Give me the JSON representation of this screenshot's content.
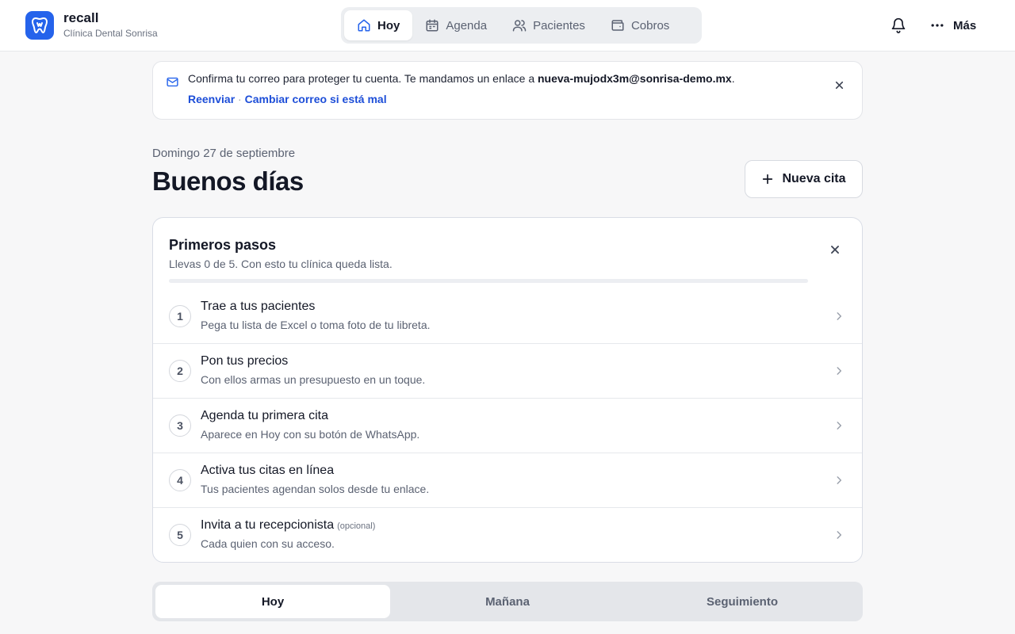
{
  "brand": {
    "name": "recall",
    "clinic": "Clínica Dental Sonrisa",
    "logo_icon": "tooth-icon",
    "accent": "#2563eb"
  },
  "nav": {
    "items": [
      {
        "label": "Hoy",
        "icon": "home-icon",
        "active": true
      },
      {
        "label": "Agenda",
        "icon": "calendar-icon",
        "active": false
      },
      {
        "label": "Pacientes",
        "icon": "users-icon",
        "active": false
      },
      {
        "label": "Cobros",
        "icon": "wallet-icon",
        "active": false
      }
    ],
    "more_label": "Más",
    "notifications_icon": "bell-icon"
  },
  "banner": {
    "icon": "mail-icon",
    "message": "Confirma tu correo para proteger tu cuenta. Te mandamos un enlace a ",
    "email": "nueva-mujodx3m@sonrisa-demo.mx",
    "message_end": ".",
    "resend_label": "Reenviar",
    "separator": "·",
    "change_label": "Cambiar correo si está mal"
  },
  "header": {
    "date": "Domingo 27 de septiembre",
    "greeting": "Buenos días",
    "new_appointment_label": "Nueva cita"
  },
  "onboarding": {
    "title": "Primeros pasos",
    "subtitle": "Llevas 0 de 5. Con esto tu clínica queda lista.",
    "progress_fraction": 0,
    "steps": [
      {
        "number": "1",
        "title": "Trae a tus pacientes",
        "optional": "",
        "description": "Pega tu lista de Excel o toma foto de tu libreta."
      },
      {
        "number": "2",
        "title": "Pon tus precios",
        "optional": "",
        "description": "Con ellos armas un presupuesto en un toque."
      },
      {
        "number": "3",
        "title": "Agenda tu primera cita",
        "optional": "",
        "description": "Aparece en Hoy con su botón de WhatsApp."
      },
      {
        "number": "4",
        "title": "Activa tus citas en línea",
        "optional": "",
        "description": "Tus pacientes agendan solos desde tu enlace."
      },
      {
        "number": "5",
        "title": "Invita a tu recepcionista",
        "optional": "(opcional)",
        "description": "Cada quien con su acceso."
      }
    ]
  },
  "day_tabs": [
    {
      "label": "Hoy",
      "active": true
    },
    {
      "label": "Mañana",
      "active": false
    },
    {
      "label": "Seguimiento",
      "active": false
    }
  ]
}
